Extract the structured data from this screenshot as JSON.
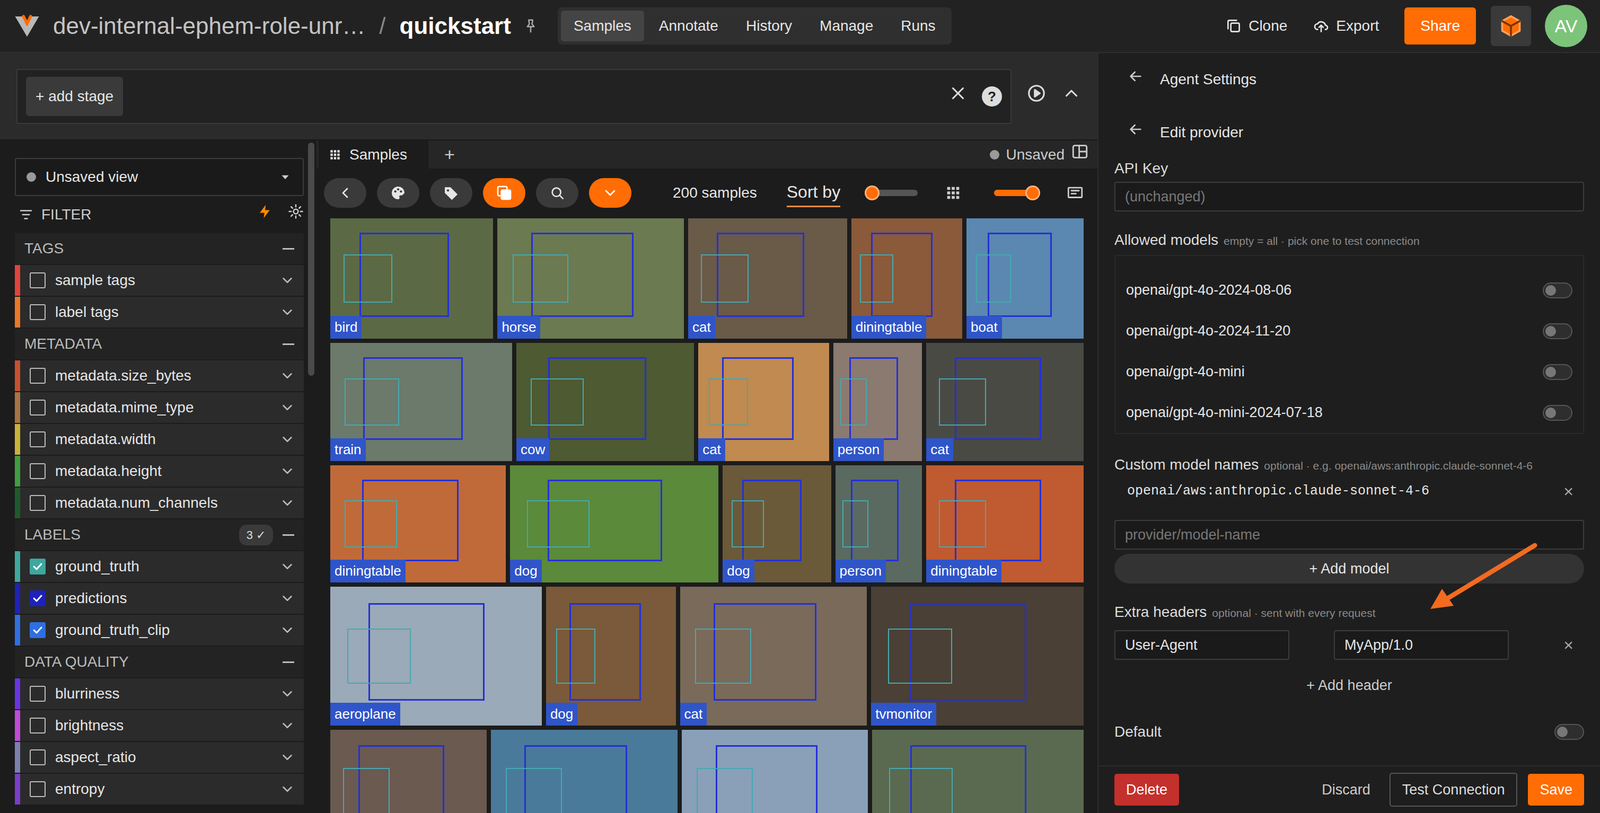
{
  "topbar": {
    "org": "dev-internal-ephem-role-unr…",
    "separator": "/",
    "dataset": "quickstart",
    "tabs": [
      {
        "label": "Samples",
        "selected": true
      },
      {
        "label": "Annotate",
        "selected": false
      },
      {
        "label": "History",
        "selected": false
      },
      {
        "label": "Manage",
        "selected": false
      },
      {
        "label": "Runs",
        "selected": false
      }
    ],
    "actions": [
      "Clone",
      "Export"
    ],
    "share": "Share",
    "avatar": "AV"
  },
  "stage": {
    "add": "+ add stage",
    "help": "?"
  },
  "sidebar": {
    "view": "Unsaved view",
    "filter": "FILTER",
    "sections": [
      {
        "title": "TAGS",
        "expanded": true,
        "items": [
          {
            "name": "sample tags",
            "checked": false,
            "color": "#e0443c"
          },
          {
            "name": "label tags",
            "checked": false,
            "color": "#e8782a"
          }
        ]
      },
      {
        "title": "METADATA",
        "expanded": true,
        "items": [
          {
            "name": "metadata.size_bytes",
            "checked": false,
            "color": "#c8502e"
          },
          {
            "name": "metadata.mime_type",
            "checked": false,
            "color": "#a87443"
          },
          {
            "name": "metadata.width",
            "checked": false,
            "color": "#c9b33a"
          },
          {
            "name": "metadata.height",
            "checked": false,
            "color": "#3f9e3f"
          },
          {
            "name": "metadata.num_channels",
            "checked": false,
            "color": "#1f5a2c"
          }
        ]
      },
      {
        "title": "LABELS",
        "expanded": true,
        "badge": "3 ✓",
        "items": [
          {
            "name": "ground_truth",
            "checked": true,
            "color": "#3fa6a0"
          },
          {
            "name": "predictions",
            "checked": true,
            "color": "#1e22b8"
          },
          {
            "name": "ground_truth_clip",
            "checked": true,
            "color": "#2f6fe0"
          }
        ]
      },
      {
        "title": "DATA QUALITY",
        "expanded": true,
        "items": [
          {
            "name": "blurriness",
            "checked": false,
            "color": "#6a35e0"
          },
          {
            "name": "brightness",
            "checked": false,
            "color": "#c24ad8"
          },
          {
            "name": "aspect_ratio",
            "checked": false,
            "color": "#7d7fae"
          },
          {
            "name": "entropy",
            "checked": false,
            "color": "#7a3dc8"
          }
        ]
      }
    ]
  },
  "samples": {
    "tab": "Samples",
    "add_tab": "+",
    "status": "Unsaved",
    "count": "200 samples",
    "sort": "Sort by",
    "sliders": [
      {
        "level": 0
      },
      {
        "level": 0.85
      }
    ],
    "rows": [
      [
        {
          "label": "bird"
        },
        {
          "label": "horse"
        },
        {
          "label": "cat"
        },
        {
          "label": "diningtable"
        },
        {
          "label": "boat"
        }
      ],
      [
        {
          "label": "train"
        },
        {
          "label": "cow"
        },
        {
          "label": "cat"
        },
        {
          "label": "person"
        },
        {
          "label": "cat"
        }
      ],
      [
        {
          "label": "diningtable"
        },
        {
          "label": "dog"
        },
        {
          "label": "dog"
        },
        {
          "label": "person"
        },
        {
          "label": "diningtable"
        }
      ],
      [
        {
          "label": "aeroplane"
        },
        {
          "label": "dog"
        },
        {
          "label": "cat"
        },
        {
          "label": "tvmonitor"
        }
      ]
    ]
  },
  "panel": {
    "title": "Agent Settings",
    "subtitle": "Edit provider",
    "api_key": {
      "label": "API Key",
      "placeholder": "(unchanged)"
    },
    "allowed": {
      "label": "Allowed models",
      "hint": "empty = all · pick one to test connection",
      "items": [
        {
          "name": "openai/gpt-4o-2024-08-06",
          "on": false
        },
        {
          "name": "openai/gpt-4o-2024-11-20",
          "on": false
        },
        {
          "name": "openai/gpt-4o-mini",
          "on": false
        },
        {
          "name": "openai/gpt-4o-mini-2024-07-18",
          "on": false
        }
      ]
    },
    "custom": {
      "label": "Custom model names",
      "hint": "optional · e.g. openai/aws:anthropic.claude-sonnet-4-6",
      "items": [
        {
          "name": "openai/aws:anthropic.claude-sonnet-4-6",
          "remove": "×"
        }
      ],
      "placeholder": "provider/model-name",
      "add": "+ Add model"
    },
    "headers": {
      "label": "Extra headers",
      "hint": "optional · sent with every request",
      "items": [
        {
          "key": "User-Agent",
          "value": "MyApp/1.0",
          "remove": "×"
        }
      ],
      "add": "+ Add header"
    },
    "default": {
      "label": "Default",
      "on": false
    },
    "buttons": {
      "delete": "Delete",
      "discard": "Discard",
      "test": "Test Connection",
      "save": "Save"
    }
  }
}
